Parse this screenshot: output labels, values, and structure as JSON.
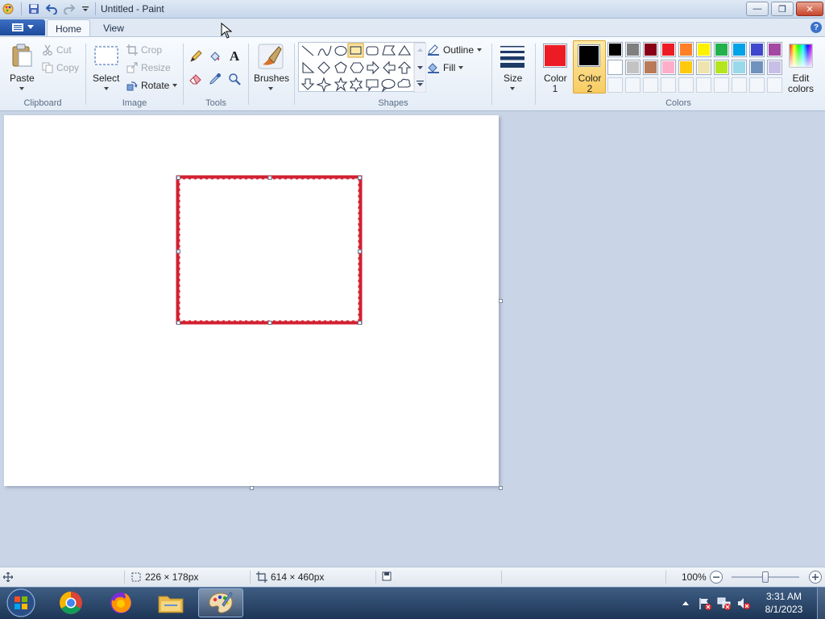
{
  "window": {
    "title": "Untitled - Paint",
    "minimize_symbol": "—",
    "maximize_symbol": "❐",
    "close_symbol": "✕"
  },
  "tabs": [
    {
      "label": "Home",
      "active": true
    },
    {
      "label": "View",
      "active": false
    }
  ],
  "ribbon": {
    "clipboard": {
      "group": "Clipboard",
      "paste": "Paste",
      "cut": "Cut",
      "copy": "Copy"
    },
    "image": {
      "group": "Image",
      "select": "Select",
      "crop": "Crop",
      "resize": "Resize",
      "rotate": "Rotate"
    },
    "tools": {
      "group": "Tools",
      "text_glyph": "A"
    },
    "brushes": {
      "label": "Brushes"
    },
    "shapes": {
      "group": "Shapes",
      "outline": "Outline",
      "fill": "Fill"
    },
    "size": {
      "label": "Size"
    },
    "colors": {
      "group": "Colors",
      "color1_line1": "Color",
      "color1_line2": "1",
      "color2_line1": "Color",
      "color2_line2": "2",
      "edit_line1": "Edit",
      "edit_line2": "colors",
      "color1": "#ed1c24",
      "color2": "#000000",
      "palette_row1": [
        "#000000",
        "#7f7f7f",
        "#880015",
        "#ed1c24",
        "#ff7f27",
        "#fff200",
        "#22b14c",
        "#00a2e8",
        "#3f48cc",
        "#a349a4"
      ],
      "palette_row2": [
        "#ffffff",
        "#c3c3c3",
        "#b97a57",
        "#ffaec9",
        "#ffc90e",
        "#efe4b0",
        "#b5e61d",
        "#99d9ea",
        "#7092be",
        "#c8bfe7"
      ]
    }
  },
  "canvas": {
    "rect_color": "#d22030"
  },
  "status": {
    "selection_size": "226 × 178px",
    "canvas_size": "614 × 460px",
    "zoom": "100%",
    "zoom_fraction": 0.5
  },
  "clock": {
    "time": "3:31 AM",
    "date": "8/1/2023"
  }
}
